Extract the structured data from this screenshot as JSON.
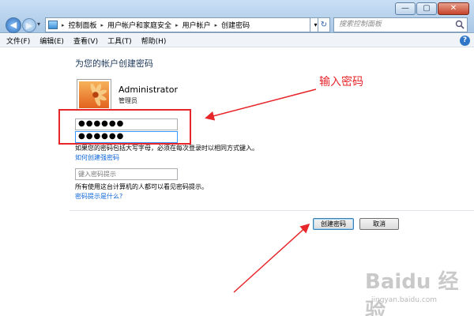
{
  "window": {
    "minimize": "—",
    "maximize": "▢",
    "close": "✕"
  },
  "nav": {
    "back": "◀",
    "forward": "▶",
    "dropdown": "▾",
    "address_dropdown": "▾",
    "refresh": "↻"
  },
  "breadcrumb": [
    "控制面板",
    "用户帐户和家庭安全",
    "用户帐户",
    "创建密码"
  ],
  "breadcrumb_sep": "▸",
  "search": {
    "placeholder": "搜索控制面板"
  },
  "menu": [
    "文件(F)",
    "编辑(E)",
    "查看(V)",
    "工具(T)",
    "帮助(H)"
  ],
  "help_symbol": "?",
  "page_title": "为您的帐户创建密码",
  "user": {
    "name": "Administrator",
    "role": "管理员"
  },
  "password1": "●●●●●●",
  "password2": "●●●●●●",
  "note_case": "如果您的密码包括大写字母，必须在每次登录时以相同方式键入。",
  "link_strong": "如何创建强密码",
  "hint_placeholder": "键入密码提示",
  "note_visible": "所有使用这台计算机的人都可以看见密码提示。",
  "link_hint": "密码提示是什么?",
  "buttons": {
    "create": "创建密码",
    "cancel": "取消"
  },
  "annotation": "输入密码",
  "colors": {
    "annotation": "#e6262a",
    "link": "#0a64d6",
    "title": "#1e395b"
  },
  "watermark": {
    "logo": "Baidu 经验",
    "url": "jingyan.baidu.com"
  }
}
